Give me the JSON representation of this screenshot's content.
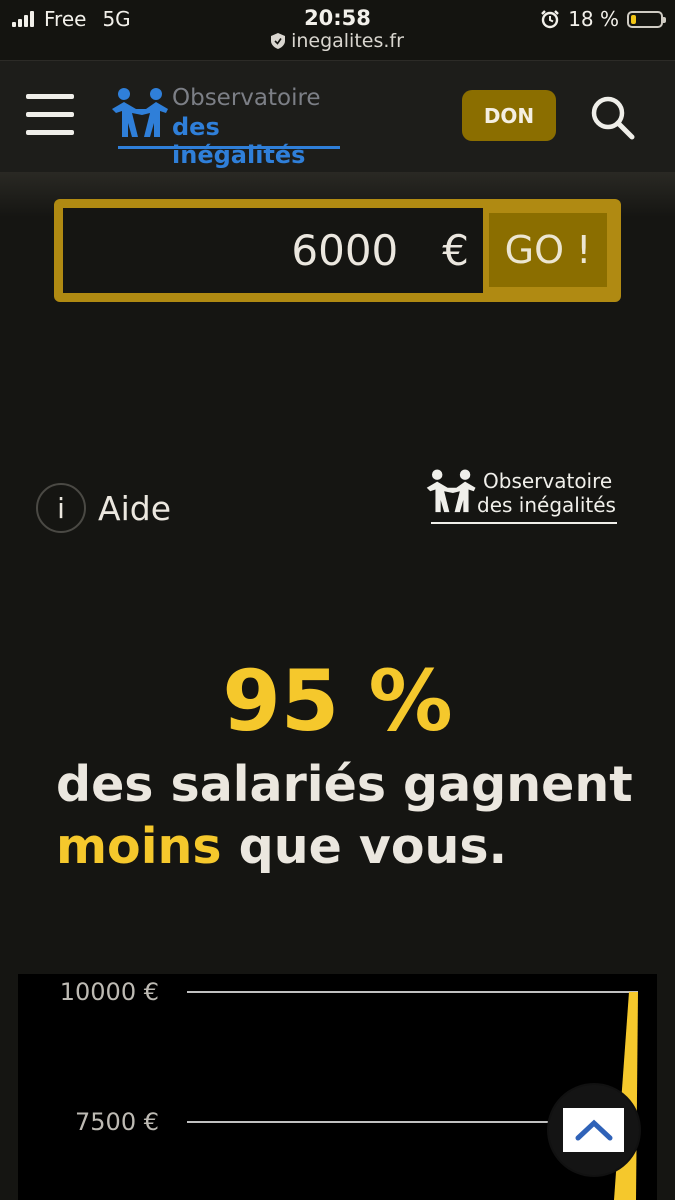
{
  "status_bar": {
    "carrier": "Free",
    "network": "5G",
    "time": "20:58",
    "url": "inegalites.fr",
    "battery": "18 %"
  },
  "header": {
    "logo_line1": "Observatoire",
    "logo_line2": "des inégalités",
    "don_label": "DON"
  },
  "salary_form": {
    "value": "6000",
    "currency": "€",
    "go_label": "GO !"
  },
  "aide": {
    "icon_glyph": "i",
    "label": "Aide"
  },
  "small_logo": {
    "line1": "Observatoire",
    "line2": "des inégalités"
  },
  "result": {
    "percent": "95 %",
    "line1": "des salariés gagnent",
    "highlight": "moins",
    "line2_rest": "que vous."
  },
  "chart_data": {
    "type": "area",
    "y_ticks": [
      {
        "value": 10000,
        "label": "10000 €"
      },
      {
        "value": 7500,
        "label": "7500 €"
      }
    ],
    "colors": {
      "curve": "#f5c82c",
      "gridline": "#ffffff"
    }
  },
  "colors": {
    "accent_gold": "#8b6e00",
    "highlight_yellow": "#f5c82c",
    "brand_blue": "#2f7fd9"
  }
}
